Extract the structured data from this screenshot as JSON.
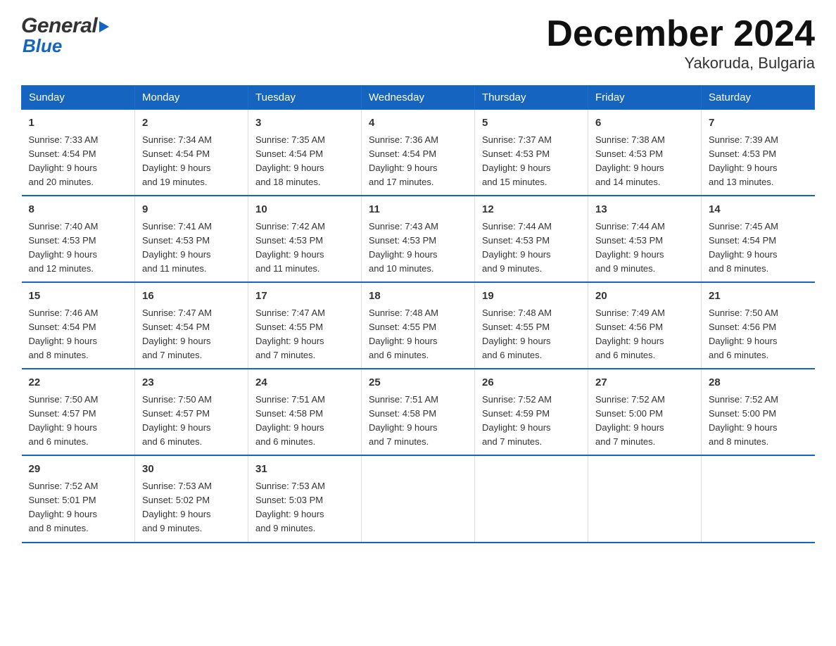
{
  "logo": {
    "line1": "General",
    "line2": "Blue"
  },
  "title": "December 2024",
  "subtitle": "Yakoruda, Bulgaria",
  "days_of_week": [
    "Sunday",
    "Monday",
    "Tuesday",
    "Wednesday",
    "Thursday",
    "Friday",
    "Saturday"
  ],
  "weeks": [
    [
      {
        "day": "1",
        "sunrise": "7:33 AM",
        "sunset": "4:54 PM",
        "daylight": "9 hours and 20 minutes."
      },
      {
        "day": "2",
        "sunrise": "7:34 AM",
        "sunset": "4:54 PM",
        "daylight": "9 hours and 19 minutes."
      },
      {
        "day": "3",
        "sunrise": "7:35 AM",
        "sunset": "4:54 PM",
        "daylight": "9 hours and 18 minutes."
      },
      {
        "day": "4",
        "sunrise": "7:36 AM",
        "sunset": "4:54 PM",
        "daylight": "9 hours and 17 minutes."
      },
      {
        "day": "5",
        "sunrise": "7:37 AM",
        "sunset": "4:53 PM",
        "daylight": "9 hours and 15 minutes."
      },
      {
        "day": "6",
        "sunrise": "7:38 AM",
        "sunset": "4:53 PM",
        "daylight": "9 hours and 14 minutes."
      },
      {
        "day": "7",
        "sunrise": "7:39 AM",
        "sunset": "4:53 PM",
        "daylight": "9 hours and 13 minutes."
      }
    ],
    [
      {
        "day": "8",
        "sunrise": "7:40 AM",
        "sunset": "4:53 PM",
        "daylight": "9 hours and 12 minutes."
      },
      {
        "day": "9",
        "sunrise": "7:41 AM",
        "sunset": "4:53 PM",
        "daylight": "9 hours and 11 minutes."
      },
      {
        "day": "10",
        "sunrise": "7:42 AM",
        "sunset": "4:53 PM",
        "daylight": "9 hours and 11 minutes."
      },
      {
        "day": "11",
        "sunrise": "7:43 AM",
        "sunset": "4:53 PM",
        "daylight": "9 hours and 10 minutes."
      },
      {
        "day": "12",
        "sunrise": "7:44 AM",
        "sunset": "4:53 PM",
        "daylight": "9 hours and 9 minutes."
      },
      {
        "day": "13",
        "sunrise": "7:44 AM",
        "sunset": "4:53 PM",
        "daylight": "9 hours and 9 minutes."
      },
      {
        "day": "14",
        "sunrise": "7:45 AM",
        "sunset": "4:54 PM",
        "daylight": "9 hours and 8 minutes."
      }
    ],
    [
      {
        "day": "15",
        "sunrise": "7:46 AM",
        "sunset": "4:54 PM",
        "daylight": "9 hours and 8 minutes."
      },
      {
        "day": "16",
        "sunrise": "7:47 AM",
        "sunset": "4:54 PM",
        "daylight": "9 hours and 7 minutes."
      },
      {
        "day": "17",
        "sunrise": "7:47 AM",
        "sunset": "4:55 PM",
        "daylight": "9 hours and 7 minutes."
      },
      {
        "day": "18",
        "sunrise": "7:48 AM",
        "sunset": "4:55 PM",
        "daylight": "9 hours and 6 minutes."
      },
      {
        "day": "19",
        "sunrise": "7:48 AM",
        "sunset": "4:55 PM",
        "daylight": "9 hours and 6 minutes."
      },
      {
        "day": "20",
        "sunrise": "7:49 AM",
        "sunset": "4:56 PM",
        "daylight": "9 hours and 6 minutes."
      },
      {
        "day": "21",
        "sunrise": "7:50 AM",
        "sunset": "4:56 PM",
        "daylight": "9 hours and 6 minutes."
      }
    ],
    [
      {
        "day": "22",
        "sunrise": "7:50 AM",
        "sunset": "4:57 PM",
        "daylight": "9 hours and 6 minutes."
      },
      {
        "day": "23",
        "sunrise": "7:50 AM",
        "sunset": "4:57 PM",
        "daylight": "9 hours and 6 minutes."
      },
      {
        "day": "24",
        "sunrise": "7:51 AM",
        "sunset": "4:58 PM",
        "daylight": "9 hours and 6 minutes."
      },
      {
        "day": "25",
        "sunrise": "7:51 AM",
        "sunset": "4:58 PM",
        "daylight": "9 hours and 7 minutes."
      },
      {
        "day": "26",
        "sunrise": "7:52 AM",
        "sunset": "4:59 PM",
        "daylight": "9 hours and 7 minutes."
      },
      {
        "day": "27",
        "sunrise": "7:52 AM",
        "sunset": "5:00 PM",
        "daylight": "9 hours and 7 minutes."
      },
      {
        "day": "28",
        "sunrise": "7:52 AM",
        "sunset": "5:00 PM",
        "daylight": "9 hours and 8 minutes."
      }
    ],
    [
      {
        "day": "29",
        "sunrise": "7:52 AM",
        "sunset": "5:01 PM",
        "daylight": "9 hours and 8 minutes."
      },
      {
        "day": "30",
        "sunrise": "7:53 AM",
        "sunset": "5:02 PM",
        "daylight": "9 hours and 9 minutes."
      },
      {
        "day": "31",
        "sunrise": "7:53 AM",
        "sunset": "5:03 PM",
        "daylight": "9 hours and 9 minutes."
      },
      null,
      null,
      null,
      null
    ]
  ],
  "labels": {
    "sunrise_prefix": "Sunrise: ",
    "sunset_prefix": "Sunset: ",
    "daylight_prefix": "Daylight: "
  }
}
